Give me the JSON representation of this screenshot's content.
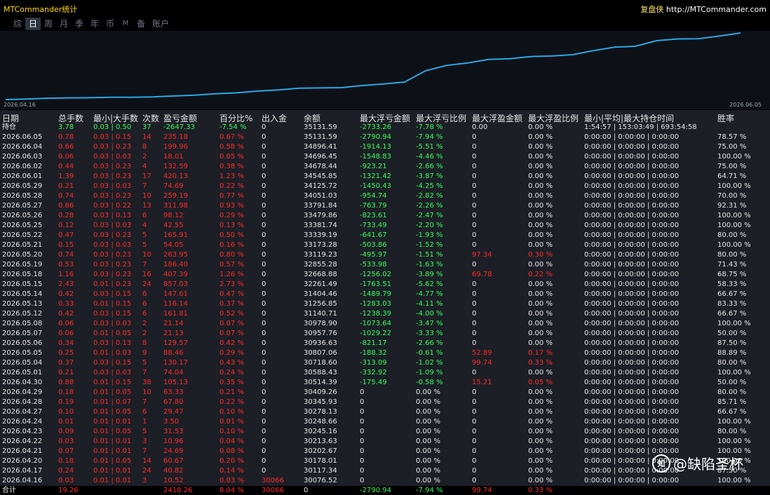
{
  "window": {
    "title": "MTCommander统计",
    "brand": "复盘侠",
    "url": "http://MTCommander.com"
  },
  "tabs": [
    "综",
    "日",
    "周",
    "月",
    "季",
    "年",
    "币",
    "M",
    "备",
    "账户"
  ],
  "active_tab": "日",
  "chart": {
    "start_label": "2026.04.16",
    "end_label": "2026.06.05",
    "line_color": "#2ba7e6"
  },
  "columns": [
    "日期",
    "总手数",
    "最小|大手数",
    "次数",
    "盈亏金额",
    "百分比%",
    "出入金",
    "余额",
    "最大浮亏金额",
    "最大浮亏比例",
    "最大浮盈金额",
    "最大浮盈比例",
    "最小|平均|最大持仓时间",
    "胜率"
  ],
  "position_row": {
    "date": "持仓",
    "lots": "3.78",
    "minmax": "0.03 | 0.50",
    "count": "37",
    "pnl": "-2647.33",
    "pct": "-7.54 %",
    "flow": "0",
    "balance": "35131.59",
    "max_float_loss": "-2733.26",
    "max_float_loss_pct": "-7.78 %",
    "max_float_profit": "0.00",
    "max_float_profit_pct": "0.00 %",
    "hold": "1:54:57 | 153:03:49 | 693:54:58",
    "win": ""
  },
  "rows": [
    {
      "date": "2026.06.05",
      "lots": "0.78",
      "minmax": "0.03 | 0.15",
      "count": "14",
      "pnl": "235.18",
      "pct": "0.67 %",
      "flow": "0",
      "balance": "35131.59",
      "mfl": "-2790.94",
      "mflp": "-7.94 %",
      "mfp": "0",
      "mfpp": "0.00 %",
      "hold": "0:00:00 | 0:00:00 | 0:00:00",
      "win": "78.57 %"
    },
    {
      "date": "2026.06.04",
      "lots": "0.66",
      "minmax": "0.03 | 0.23",
      "count": "8",
      "pnl": "199.96",
      "pct": "0.58 %",
      "flow": "0",
      "balance": "34896.41",
      "mfl": "-1914.13",
      "mflp": "-5.51 %",
      "mfp": "0",
      "mfpp": "0.00 %",
      "hold": "0:00:00 | 0:00:00 | 0:00:00",
      "win": "75.00 %"
    },
    {
      "date": "2026.06.03",
      "lots": "0.06",
      "minmax": "0.03 | 0.03",
      "count": "2",
      "pnl": "18.01",
      "pct": "0.05 %",
      "flow": "0",
      "balance": "34696.45",
      "mfl": "-1548.83",
      "mflp": "-4.46 %",
      "mfp": "0",
      "mfpp": "0.00 %",
      "hold": "0:00:00 | 0:00:00 | 0:00:00",
      "win": "100.00 %"
    },
    {
      "date": "2026.06.02",
      "lots": "0.44",
      "minmax": "0.03 | 0.23",
      "count": "4",
      "pnl": "132.59",
      "pct": "0.38 %",
      "flow": "0",
      "balance": "34678.44",
      "mfl": "-923.21",
      "mflp": "-2.66 %",
      "mfp": "0",
      "mfpp": "0.00 %",
      "hold": "0:00:00 | 0:00:00 | 0:00:00",
      "win": "75.00 %"
    },
    {
      "date": "2026.06.01",
      "lots": "1.39",
      "minmax": "0.03 | 0.23",
      "count": "17",
      "pnl": "420.13",
      "pct": "1.23 %",
      "flow": "0",
      "balance": "34545.85",
      "mfl": "-1321.42",
      "mflp": "-3.87 %",
      "mfp": "0",
      "mfpp": "0.00 %",
      "hold": "0:00:00 | 0:00:00 | 0:00:00",
      "win": "64.71 %"
    },
    {
      "date": "2026.05.29",
      "lots": "0.21",
      "minmax": "0.03 | 0.03",
      "count": "7",
      "pnl": "74.69",
      "pct": "0.22 %",
      "flow": "0",
      "balance": "34125.72",
      "mfl": "-1450.43",
      "mflp": "-4.25 %",
      "mfp": "0",
      "mfpp": "0.00 %",
      "hold": "0:00:00 | 0:00:00 | 0:00:00",
      "win": "100.00 %"
    },
    {
      "date": "2026.05.28",
      "lots": "0.74",
      "minmax": "0.03 | 0.23",
      "count": "10",
      "pnl": "259.19",
      "pct": "0.77 %",
      "flow": "0",
      "balance": "34051.03",
      "mfl": "-954.74",
      "mflp": "-2.82 %",
      "mfp": "0",
      "mfpp": "0.00 %",
      "hold": "0:00:00 | 0:00:00 | 0:00:00",
      "win": "70.00 %"
    },
    {
      "date": "2026.05.27",
      "lots": "0.86",
      "minmax": "0.03 | 0.22",
      "count": "13",
      "pnl": "311.98",
      "pct": "0.93 %",
      "flow": "0",
      "balance": "33791.84",
      "mfl": "-763.79",
      "mflp": "-2.26 %",
      "mfp": "0",
      "mfpp": "0.00 %",
      "hold": "0:00:00 | 0:00:00 | 0:00:00",
      "win": "92.31 %"
    },
    {
      "date": "2026.05.26",
      "lots": "0.28",
      "minmax": "0.03 | 0.13",
      "count": "6",
      "pnl": "98.12",
      "pct": "0.29 %",
      "flow": "0",
      "balance": "33479.86",
      "mfl": "-823.61",
      "mflp": "-2.47 %",
      "mfp": "0",
      "mfpp": "0.00 %",
      "hold": "0:00:00 | 0:00:00 | 0:00:00",
      "win": "100.00 %"
    },
    {
      "date": "2026.05.25",
      "lots": "0.12",
      "minmax": "0.03 | 0.03",
      "count": "4",
      "pnl": "42.55",
      "pct": "0.13 %",
      "flow": "0",
      "balance": "33381.74",
      "mfl": "-733.49",
      "mflp": "-2.20 %",
      "mfp": "0",
      "mfpp": "0.00 %",
      "hold": "0:00:00 | 0:00:00 | 0:00:00",
      "win": "100.00 %"
    },
    {
      "date": "2026.05.22",
      "lots": "0.47",
      "minmax": "0.03 | 0.23",
      "count": "5",
      "pnl": "165.91",
      "pct": "0.50 %",
      "flow": "0",
      "balance": "33339.19",
      "mfl": "-641.67",
      "mflp": "-1.93 %",
      "mfp": "0",
      "mfpp": "0.00 %",
      "hold": "0:00:00 | 0:00:00 | 0:00:00",
      "win": "80.00 %"
    },
    {
      "date": "2026.05.21",
      "lots": "0.15",
      "minmax": "0.03 | 0.03",
      "count": "5",
      "pnl": "54.05",
      "pct": "0.16 %",
      "flow": "0",
      "balance": "33173.28",
      "mfl": "-503.86",
      "mflp": "-1.52 %",
      "mfp": "0",
      "mfpp": "0.00 %",
      "hold": "0:00:00 | 0:00:00 | 0:00:00",
      "win": "100.00 %"
    },
    {
      "date": "2026.05.20",
      "lots": "0.74",
      "minmax": "0.03 | 0.23",
      "count": "10",
      "pnl": "263.95",
      "pct": "0.80 %",
      "flow": "0",
      "balance": "33119.23",
      "mfl": "-495.97",
      "mflp": "-1.51 %",
      "mfp": "97.34",
      "mfpp": "0.30 %",
      "hold": "0:00:00 | 0:00:00 | 0:00:00",
      "win": "80.00 %"
    },
    {
      "date": "2026.05.19",
      "lots": "0.53",
      "minmax": "0.03 | 0.23",
      "count": "7",
      "pnl": "186.40",
      "pct": "0.57 %",
      "flow": "0",
      "balance": "32855.28",
      "mfl": "-533.98",
      "mflp": "-1.63 %",
      "mfp": "0",
      "mfpp": "0.00 %",
      "hold": "0:00:00 | 0:00:00 | 0:00:00",
      "win": "71.43 %"
    },
    {
      "date": "2026.05.18",
      "lots": "1.16",
      "minmax": "0.03 | 0.23",
      "count": "16",
      "pnl": "407.39",
      "pct": "1.26 %",
      "flow": "0",
      "balance": "32668.88",
      "mfl": "-1256.02",
      "mflp": "-3.89 %",
      "mfp": "69.78",
      "mfpp": "0.22 %",
      "hold": "0:00:00 | 0:00:00 | 0:00:00",
      "win": "68.75 %"
    },
    {
      "date": "2026.05.15",
      "lots": "2.43",
      "minmax": "0.01 | 0.23",
      "count": "24",
      "pnl": "857.03",
      "pct": "2.73 %",
      "flow": "0",
      "balance": "32261.49",
      "mfl": "-1763.51",
      "mflp": "-5.62 %",
      "mfp": "0",
      "mfpp": "0.00 %",
      "hold": "0:00:00 | 0:00:00 | 0:00:00",
      "win": "58.33 %"
    },
    {
      "date": "2026.05.14",
      "lots": "0.42",
      "minmax": "0.03 | 0.15",
      "count": "6",
      "pnl": "147.61",
      "pct": "0.47 %",
      "flow": "0",
      "balance": "31404.46",
      "mfl": "-1489.79",
      "mflp": "-4.77 %",
      "mfp": "0",
      "mfpp": "0.00 %",
      "hold": "0:00:00 | 0:00:00 | 0:00:00",
      "win": "66.67 %"
    },
    {
      "date": "2026.05.13",
      "lots": "0.33",
      "minmax": "0.01 | 0.15",
      "count": "6",
      "pnl": "116.14",
      "pct": "0.37 %",
      "flow": "0",
      "balance": "31256.85",
      "mfl": "-1283.03",
      "mflp": "-4.11 %",
      "mfp": "0",
      "mfpp": "0.00 %",
      "hold": "0:00:00 | 0:00:00 | 0:00:00",
      "win": "83.33 %"
    },
    {
      "date": "2026.05.12",
      "lots": "0.42",
      "minmax": "0.03 | 0.15",
      "count": "6",
      "pnl": "161.81",
      "pct": "0.52 %",
      "flow": "0",
      "balance": "31140.71",
      "mfl": "-1238.39",
      "mflp": "-4.00 %",
      "mfp": "0",
      "mfpp": "0.00 %",
      "hold": "0:00:00 | 0:00:00 | 0:00:00",
      "win": "66.67 %"
    },
    {
      "date": "2026.05.08",
      "lots": "0.06",
      "minmax": "0.03 | 0.03",
      "count": "2",
      "pnl": "21.14",
      "pct": "0.07 %",
      "flow": "0",
      "balance": "30978.90",
      "mfl": "-1073.64",
      "mflp": "-3.47 %",
      "mfp": "0",
      "mfpp": "0.00 %",
      "hold": "0:00:00 | 0:00:00 | 0:00:00",
      "win": "100.00 %"
    },
    {
      "date": "2026.05.07",
      "lots": "0.06",
      "minmax": "0.01 | 0.05",
      "count": "2",
      "pnl": "21.13",
      "pct": "0.07 %",
      "flow": "0",
      "balance": "30957.76",
      "mfl": "-1029.22",
      "mflp": "-3.33 %",
      "mfp": "0",
      "mfpp": "0.00 %",
      "hold": "0:00:00 | 0:00:00 | 0:00:00",
      "win": "50.00 %"
    },
    {
      "date": "2026.05.06",
      "lots": "0.34",
      "minmax": "0.03 | 0.13",
      "count": "8",
      "pnl": "129.57",
      "pct": "0.42 %",
      "flow": "0",
      "balance": "30936.63",
      "mfl": "-821.17",
      "mflp": "-2.66 %",
      "mfp": "0",
      "mfpp": "0.00 %",
      "hold": "0:00:00 | 0:00:00 | 0:00:00",
      "win": "87.50 %"
    },
    {
      "date": "2026.05.05",
      "lots": "0.25",
      "minmax": "0.01 | 0.03",
      "count": "9",
      "pnl": "88.46",
      "pct": "0.29 %",
      "flow": "0",
      "balance": "30807.06",
      "mfl": "-188.32",
      "mflp": "-0.61 %",
      "mfp": "52.89",
      "mfpp": "0.17 %",
      "hold": "0:00:00 | 0:00:00 | 0:00:00",
      "win": "88.89 %"
    },
    {
      "date": "2026.05.04",
      "lots": "0.37",
      "minmax": "0.03 | 0.15",
      "count": "5",
      "pnl": "130.17",
      "pct": "0.43 %",
      "flow": "0",
      "balance": "30718.60",
      "mfl": "-313.09",
      "mflp": "-1.02 %",
      "mfp": "99.74",
      "mfpp": "0.33 %",
      "hold": "0:00:00 | 0:00:00 | 0:00:00",
      "win": "80.00 %"
    },
    {
      "date": "2026.05.01",
      "lots": "0.21",
      "minmax": "0.03 | 0.03",
      "count": "7",
      "pnl": "74.04",
      "pct": "0.24 %",
      "flow": "0",
      "balance": "30588.43",
      "mfl": "-332.92",
      "mflp": "-1.09 %",
      "mfp": "0",
      "mfpp": "0.00 %",
      "hold": "0:00:00 | 0:00:00 | 0:00:00",
      "win": "100.00 %"
    },
    {
      "date": "2026.04.30",
      "lots": "0.88",
      "minmax": "0.01 | 0.15",
      "count": "38",
      "pnl": "105.13",
      "pct": "0.35 %",
      "flow": "0",
      "balance": "30514.39",
      "mfl": "-175.49",
      "mflp": "-0.58 %",
      "mfp": "15.21",
      "mfpp": "0.05 %",
      "hold": "0:00:00 | 0:00:00 | 0:00:00",
      "win": "50.00 %"
    },
    {
      "date": "2026.04.29",
      "lots": "0.18",
      "minmax": "0.01 | 0.05",
      "count": "10",
      "pnl": "63.33",
      "pct": "0.21 %",
      "flow": "0",
      "balance": "30409.26",
      "mfl": "0",
      "mflp": "0.00 %",
      "mfp": "0",
      "mfpp": "0.00 %",
      "hold": "0:00:00 | 0:00:00 | 0:00:00",
      "win": "80.00 %"
    },
    {
      "date": "2026.04.28",
      "lots": "0.19",
      "minmax": "0.01 | 0.07",
      "count": "7",
      "pnl": "67.80",
      "pct": "0.22 %",
      "flow": "0",
      "balance": "30345.93",
      "mfl": "0",
      "mflp": "0.00 %",
      "mfp": "0",
      "mfpp": "0.00 %",
      "hold": "0:00:00 | 0:00:00 | 0:00:00",
      "win": "85.71 %"
    },
    {
      "date": "2026.04.27",
      "lots": "0.10",
      "minmax": "0.01 | 0.05",
      "count": "6",
      "pnl": "29.47",
      "pct": "0.10 %",
      "flow": "0",
      "balance": "30278.13",
      "mfl": "0",
      "mflp": "0.00 %",
      "mfp": "0",
      "mfpp": "0.00 %",
      "hold": "0:00:00 | 0:00:00 | 0:00:00",
      "win": "66.67 %"
    },
    {
      "date": "2026.04.24",
      "lots": "0.01",
      "minmax": "0.01 | 0.01",
      "count": "1",
      "pnl": "3.50",
      "pct": "0.01 %",
      "flow": "0",
      "balance": "30248.66",
      "mfl": "0",
      "mflp": "0.00 %",
      "mfp": "0",
      "mfpp": "0.00 %",
      "hold": "0:00:00 | 0:00:00 | 0:00:00",
      "win": "100.00 %"
    },
    {
      "date": "2026.04.23",
      "lots": "0.09",
      "minmax": "0.01 | 0.05",
      "count": "5",
      "pnl": "31.53",
      "pct": "0.10 %",
      "flow": "0",
      "balance": "30245.16",
      "mfl": "0",
      "mflp": "0.00 %",
      "mfp": "0",
      "mfpp": "0.00 %",
      "hold": "0:00:00 | 0:00:00 | 0:00:00",
      "win": "80.00 %"
    },
    {
      "date": "2026.04.22",
      "lots": "0.03",
      "minmax": "0.01 | 0.01",
      "count": "3",
      "pnl": "10.96",
      "pct": "0.04 %",
      "flow": "0",
      "balance": "30213.63",
      "mfl": "0",
      "mflp": "0.00 %",
      "mfp": "0",
      "mfpp": "0.00 %",
      "hold": "0:00:00 | 0:00:00 | 0:00:00",
      "win": "100.00 %"
    },
    {
      "date": "2026.04.21",
      "lots": "0.07",
      "minmax": "0.01 | 0.01",
      "count": "7",
      "pnl": "24.69",
      "pct": "0.08 %",
      "flow": "0",
      "balance": "30202.67",
      "mfl": "0",
      "mflp": "0.00 %",
      "mfp": "0",
      "mfpp": "0.00 %",
      "hold": "0:00:00 | 0:00:00 | 0:00:00",
      "win": "100.00 %"
    },
    {
      "date": "2026.04.20",
      "lots": "0.18",
      "minmax": "0.01 | 0.05",
      "count": "14",
      "pnl": "60.67",
      "pct": "0.20 %",
      "flow": "0",
      "balance": "30178.01",
      "mfl": "0",
      "mflp": "0.00 %",
      "mfp": "0",
      "mfpp": "0.00 %",
      "hold": "0:00:00 | 0:00:00 | 0:00:00",
      "win": "100.00 %"
    },
    {
      "date": "2026.04.17",
      "lots": "0.24",
      "minmax": "0.01 | 0.01",
      "count": "24",
      "pnl": "40.82",
      "pct": "0.14 %",
      "flow": "0",
      "balance": "30117.34",
      "mfl": "0",
      "mflp": "0.00 %",
      "mfp": "0",
      "mfpp": "0.00 %",
      "hold": "0:00:00 | 0:00:00 | 0:00:00",
      "win": "87.50 %"
    },
    {
      "date": "2026.04.16",
      "lots": "0.03",
      "minmax": "0.01 | 0.01",
      "count": "3",
      "pnl": "10.52",
      "pct": "0.03 %",
      "flow": "30066",
      "balance": "30076.52",
      "mfl": "0",
      "mflp": "0.00 %",
      "mfp": "0",
      "mfpp": "0.00 %",
      "hold": "0:00:00 | 0:00:00 | 0:00:00",
      "win": "100.00 %"
    }
  ],
  "summary": {
    "label": "合计",
    "lots": "19.26",
    "pnl": "2418.26",
    "pct": "8.04 %",
    "flow": "30066",
    "balance": "0",
    "mfl": "-2790.94",
    "mflp": "-7.94 %",
    "mfp": "99.74",
    "mfpp": "0.33 %"
  },
  "watermark": {
    "logo": "知",
    "text": "@缺陷圣杯"
  }
}
